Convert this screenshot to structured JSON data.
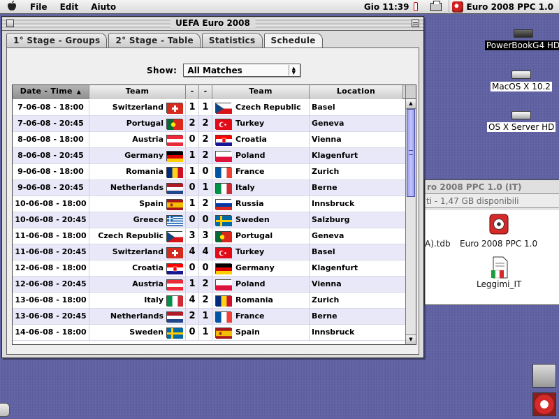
{
  "menubar": {
    "apple": "",
    "menus": [
      "File",
      "Edit",
      "Aiuto"
    ],
    "clock": "Gio 11:39",
    "app_name": "Euro 2008 PPC 1.0"
  },
  "window": {
    "title": "UEFA Euro 2008",
    "tabs": [
      "1° Stage - Groups",
      "2° Stage - Table",
      "Statistics",
      "Schedule"
    ],
    "active_tab": "Schedule",
    "show_label": "Show:",
    "show_value": "All Matches",
    "columns": {
      "date": "Date - Time",
      "team1": "Team",
      "s1": "-",
      "s2": "-",
      "team2": "Team",
      "location": "Location"
    },
    "sort_column": "Date - Time",
    "matches": [
      {
        "date": "7-06-08 - 18:00",
        "team1": "Switzerland",
        "flag1": "SUI",
        "s1": "1",
        "s2": "1",
        "team2": "Czech Republic",
        "flag2": "CZE",
        "location": "Basel"
      },
      {
        "date": "7-06-08 - 20:45",
        "team1": "Portugal",
        "flag1": "POR",
        "s1": "2",
        "s2": "2",
        "team2": "Turkey",
        "flag2": "TUR",
        "location": "Geneva"
      },
      {
        "date": "8-06-08 - 18:00",
        "team1": "Austria",
        "flag1": "AUT",
        "s1": "0",
        "s2": "2",
        "team2": "Croatia",
        "flag2": "CRO",
        "location": "Vienna"
      },
      {
        "date": "8-06-08 - 20:45",
        "team1": "Germany",
        "flag1": "GER",
        "s1": "1",
        "s2": "2",
        "team2": "Poland",
        "flag2": "POL",
        "location": "Klagenfurt"
      },
      {
        "date": "9-06-08 - 18:00",
        "team1": "Romania",
        "flag1": "ROU",
        "s1": "1",
        "s2": "0",
        "team2": "France",
        "flag2": "FRA",
        "location": "Zurich"
      },
      {
        "date": "9-06-08 - 20:45",
        "team1": "Netherlands",
        "flag1": "NED",
        "s1": "0",
        "s2": "1",
        "team2": "Italy",
        "flag2": "ITA",
        "location": "Berne"
      },
      {
        "date": "10-06-08 - 18:00",
        "team1": "Spain",
        "flag1": "ESP",
        "s1": "1",
        "s2": "2",
        "team2": "Russia",
        "flag2": "RUS",
        "location": "Innsbruck"
      },
      {
        "date": "10-06-08 - 20:45",
        "team1": "Greece",
        "flag1": "GRE",
        "s1": "0",
        "s2": "0",
        "team2": "Sweden",
        "flag2": "SWE",
        "location": "Salzburg"
      },
      {
        "date": "11-06-08 - 18:00",
        "team1": "Czech Republic",
        "flag1": "CZE",
        "s1": "3",
        "s2": "3",
        "team2": "Portugal",
        "flag2": "POR",
        "location": "Geneva"
      },
      {
        "date": "11-06-08 - 20:45",
        "team1": "Switzerland",
        "flag1": "SUI",
        "s1": "4",
        "s2": "4",
        "team2": "Turkey",
        "flag2": "TUR",
        "location": "Basel"
      },
      {
        "date": "12-06-08 - 18:00",
        "team1": "Croatia",
        "flag1": "CRO",
        "s1": "0",
        "s2": "0",
        "team2": "Germany",
        "flag2": "GER",
        "location": "Klagenfurt"
      },
      {
        "date": "12-06-08 - 20:45",
        "team1": "Austria",
        "flag1": "AUT",
        "s1": "1",
        "s2": "2",
        "team2": "Poland",
        "flag2": "POL",
        "location": "Vienna"
      },
      {
        "date": "13-06-08 - 18:00",
        "team1": "Italy",
        "flag1": "ITA",
        "s1": "4",
        "s2": "2",
        "team2": "Romania",
        "flag2": "ROU",
        "location": "Zurich"
      },
      {
        "date": "13-06-08 - 20:45",
        "team1": "Netherlands",
        "flag1": "NED",
        "s1": "2",
        "s2": "1",
        "team2": "France",
        "flag2": "FRA",
        "location": "Berne"
      },
      {
        "date": "14-06-08 - 18:00",
        "team1": "Sweden",
        "flag1": "SWE",
        "s1": "0",
        "s2": "1",
        "team2": "Spain",
        "flag2": "ESP",
        "location": "Innsbruck"
      }
    ]
  },
  "finder": {
    "title": "ro 2008 PPC 1.0 (IT)",
    "info": "ti - 1,47 GB disponibili",
    "files": [
      {
        "name": "A).tdb"
      },
      {
        "name": "Euro 2008 PPC 1.0"
      },
      {
        "name": "Leggimi_IT"
      }
    ]
  },
  "desktop": {
    "disks": [
      {
        "label": "PowerBookG4 HD",
        "selected": true
      },
      {
        "label": "MacOS X 10.2",
        "selected": false
      },
      {
        "label": "OS X Server HD",
        "selected": false
      }
    ]
  },
  "theme": {
    "desktop_bg": "#5f61a3",
    "row_alt": "#e8e8f8",
    "scroll_thumb": "#a8aaf6"
  }
}
